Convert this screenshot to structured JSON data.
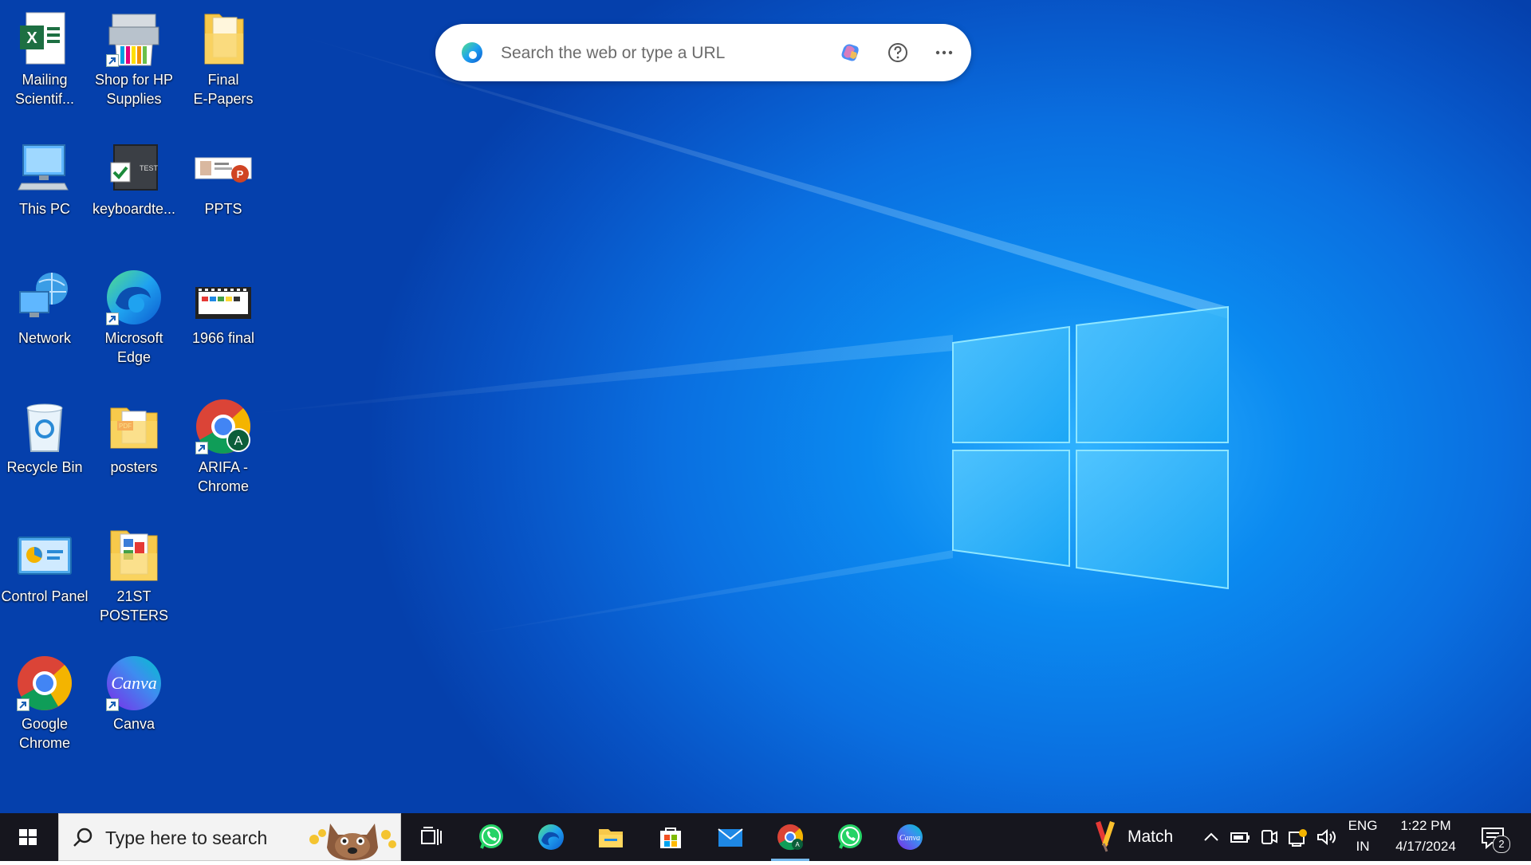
{
  "desktop": {
    "icons": [
      {
        "label": "Mailing\nScientif...",
        "icon": "excel-file-icon",
        "shortcut": false
      },
      {
        "label": "This PC",
        "icon": "this-pc-icon",
        "shortcut": false
      },
      {
        "label": "Network",
        "icon": "network-icon",
        "shortcut": false
      },
      {
        "label": "Recycle Bin",
        "icon": "recycle-bin-icon",
        "shortcut": false
      },
      {
        "label": "Control Panel",
        "icon": "control-panel-icon",
        "shortcut": false
      },
      {
        "label": "Google\nChrome",
        "icon": "chrome-icon",
        "shortcut": true
      },
      {
        "label": "Shop for HP\nSupplies",
        "icon": "hp-printer-icon",
        "shortcut": true
      },
      {
        "label": "keyboardte...",
        "icon": "keyboard-test-icon",
        "shortcut": false
      },
      {
        "label": "Microsoft\nEdge",
        "icon": "edge-icon",
        "shortcut": true
      },
      {
        "label": "posters",
        "icon": "folder-pdf-icon",
        "shortcut": false
      },
      {
        "label": "21ST\nPOSTERS",
        "icon": "folder-icon",
        "shortcut": false
      },
      {
        "label": "Canva",
        "icon": "canva-icon",
        "shortcut": true
      },
      {
        "label": "Final\nE-Papers",
        "icon": "folder-icon",
        "shortcut": false
      },
      {
        "label": "PPTS",
        "icon": "powerpoint-icon",
        "shortcut": false
      },
      {
        "label": "1966 final",
        "icon": "video-file-icon",
        "shortcut": false
      },
      {
        "label": "ARIFA -\nChrome",
        "icon": "chrome-profile-icon",
        "shortcut": true
      }
    ]
  },
  "searchbar": {
    "placeholder": "Search the web or type a URL",
    "copilot_icon": "copilot-icon",
    "help_icon": "help-icon",
    "more_icon": "more-options-icon"
  },
  "taskbar": {
    "search_placeholder": "Type here to search",
    "apps": [
      {
        "name": "task-view-icon"
      },
      {
        "name": "whatsapp-icon"
      },
      {
        "name": "edge-icon"
      },
      {
        "name": "file-explorer-icon"
      },
      {
        "name": "microsoft-store-icon"
      },
      {
        "name": "mail-icon"
      },
      {
        "name": "chrome-icon",
        "active": true
      },
      {
        "name": "whatsapp-icon"
      },
      {
        "name": "canva-icon"
      }
    ],
    "match_label": "Match",
    "language_line1": "ENG",
    "language_line2": "IN",
    "time": "1:22 PM",
    "date": "4/17/2024",
    "notification_count": "2"
  },
  "colors": {
    "taskbar": "#16161e",
    "desktop_accent": "#0a6fe0",
    "active_underline": "#76b9ed"
  }
}
